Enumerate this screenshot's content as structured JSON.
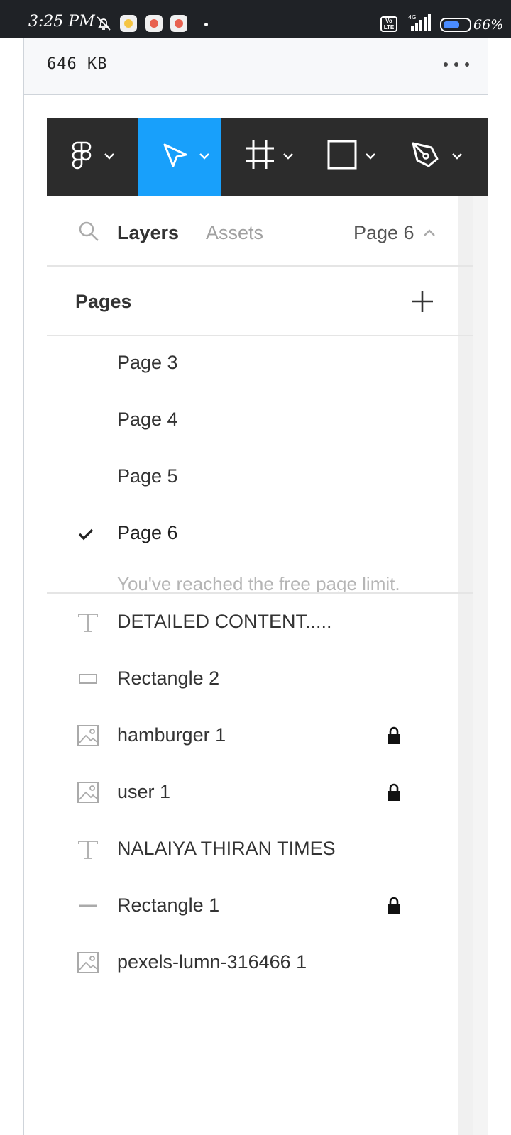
{
  "status_bar": {
    "time": "3:25 PM",
    "network": "4G",
    "volte": "Vo LTE",
    "battery": "66%",
    "battery_level": 0.66
  },
  "file": {
    "size": "646  KB"
  },
  "toolbar": {
    "tools": [
      {
        "name": "figma-menu",
        "icon": "figma-logo-icon",
        "active": false
      },
      {
        "name": "move-tool",
        "icon": "cursor-arrow-icon",
        "active": true
      },
      {
        "name": "frame-tool",
        "icon": "frame-hash-icon",
        "active": false
      },
      {
        "name": "shape-tool",
        "icon": "rectangle-icon",
        "active": false
      },
      {
        "name": "pen-tool",
        "icon": "pen-nib-icon",
        "active": false
      }
    ],
    "active_color": "#18a0fb",
    "background": "#2c2c2c"
  },
  "tabs": {
    "layers": "Layers",
    "assets": "Assets",
    "current_page": "Page 6"
  },
  "pages": {
    "title": "Pages",
    "items": [
      {
        "label": "Page 3",
        "selected": false
      },
      {
        "label": "Page 4",
        "selected": false
      },
      {
        "label": "Page 5",
        "selected": false
      },
      {
        "label": "Page 6",
        "selected": true
      }
    ],
    "limit_message": "You've reached the free page limit."
  },
  "layers": [
    {
      "label": "DETAILED CONTENT.....",
      "icon": "text-icon",
      "locked": false
    },
    {
      "label": "Rectangle 2",
      "icon": "rectangle-icon",
      "locked": false
    },
    {
      "label": "hamburger 1",
      "icon": "image-icon",
      "locked": true
    },
    {
      "label": "user 1",
      "icon": "image-icon",
      "locked": true
    },
    {
      "label": "NALAIYA THIRAN TIMES",
      "icon": "text-icon",
      "locked": false
    },
    {
      "label": "Rectangle 1",
      "icon": "line-icon",
      "locked": true
    },
    {
      "label": "pexels-lumn-316466 1",
      "icon": "image-icon",
      "locked": false
    }
  ]
}
